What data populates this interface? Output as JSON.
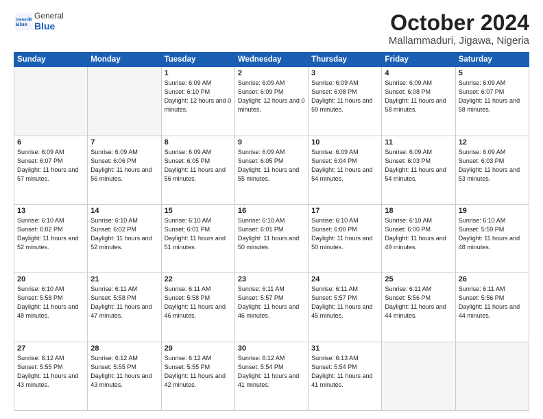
{
  "header": {
    "logo_general": "General",
    "logo_blue": "Blue",
    "title": "October 2024",
    "subtitle": "Mallammaduri, Jigawa, Nigeria"
  },
  "weekdays": [
    "Sunday",
    "Monday",
    "Tuesday",
    "Wednesday",
    "Thursday",
    "Friday",
    "Saturday"
  ],
  "weeks": [
    [
      {
        "day": "",
        "sunrise": "",
        "sunset": "",
        "daylight": ""
      },
      {
        "day": "",
        "sunrise": "",
        "sunset": "",
        "daylight": ""
      },
      {
        "day": "1",
        "sunrise": "Sunrise: 6:09 AM",
        "sunset": "Sunset: 6:10 PM",
        "daylight": "Daylight: 12 hours and 0 minutes."
      },
      {
        "day": "2",
        "sunrise": "Sunrise: 6:09 AM",
        "sunset": "Sunset: 6:09 PM",
        "daylight": "Daylight: 12 hours and 0 minutes."
      },
      {
        "day": "3",
        "sunrise": "Sunrise: 6:09 AM",
        "sunset": "Sunset: 6:08 PM",
        "daylight": "Daylight: 11 hours and 59 minutes."
      },
      {
        "day": "4",
        "sunrise": "Sunrise: 6:09 AM",
        "sunset": "Sunset: 6:08 PM",
        "daylight": "Daylight: 11 hours and 58 minutes."
      },
      {
        "day": "5",
        "sunrise": "Sunrise: 6:09 AM",
        "sunset": "Sunset: 6:07 PM",
        "daylight": "Daylight: 11 hours and 58 minutes."
      }
    ],
    [
      {
        "day": "6",
        "sunrise": "Sunrise: 6:09 AM",
        "sunset": "Sunset: 6:07 PM",
        "daylight": "Daylight: 11 hours and 57 minutes."
      },
      {
        "day": "7",
        "sunrise": "Sunrise: 6:09 AM",
        "sunset": "Sunset: 6:06 PM",
        "daylight": "Daylight: 11 hours and 56 minutes."
      },
      {
        "day": "8",
        "sunrise": "Sunrise: 6:09 AM",
        "sunset": "Sunset: 6:05 PM",
        "daylight": "Daylight: 11 hours and 56 minutes."
      },
      {
        "day": "9",
        "sunrise": "Sunrise: 6:09 AM",
        "sunset": "Sunset: 6:05 PM",
        "daylight": "Daylight: 11 hours and 55 minutes."
      },
      {
        "day": "10",
        "sunrise": "Sunrise: 6:09 AM",
        "sunset": "Sunset: 6:04 PM",
        "daylight": "Daylight: 11 hours and 54 minutes."
      },
      {
        "day": "11",
        "sunrise": "Sunrise: 6:09 AM",
        "sunset": "Sunset: 6:03 PM",
        "daylight": "Daylight: 11 hours and 54 minutes."
      },
      {
        "day": "12",
        "sunrise": "Sunrise: 6:09 AM",
        "sunset": "Sunset: 6:03 PM",
        "daylight": "Daylight: 11 hours and 53 minutes."
      }
    ],
    [
      {
        "day": "13",
        "sunrise": "Sunrise: 6:10 AM",
        "sunset": "Sunset: 6:02 PM",
        "daylight": "Daylight: 11 hours and 52 minutes."
      },
      {
        "day": "14",
        "sunrise": "Sunrise: 6:10 AM",
        "sunset": "Sunset: 6:02 PM",
        "daylight": "Daylight: 11 hours and 52 minutes."
      },
      {
        "day": "15",
        "sunrise": "Sunrise: 6:10 AM",
        "sunset": "Sunset: 6:01 PM",
        "daylight": "Daylight: 11 hours and 51 minutes."
      },
      {
        "day": "16",
        "sunrise": "Sunrise: 6:10 AM",
        "sunset": "Sunset: 6:01 PM",
        "daylight": "Daylight: 11 hours and 50 minutes."
      },
      {
        "day": "17",
        "sunrise": "Sunrise: 6:10 AM",
        "sunset": "Sunset: 6:00 PM",
        "daylight": "Daylight: 11 hours and 50 minutes."
      },
      {
        "day": "18",
        "sunrise": "Sunrise: 6:10 AM",
        "sunset": "Sunset: 6:00 PM",
        "daylight": "Daylight: 11 hours and 49 minutes."
      },
      {
        "day": "19",
        "sunrise": "Sunrise: 6:10 AM",
        "sunset": "Sunset: 5:59 PM",
        "daylight": "Daylight: 11 hours and 48 minutes."
      }
    ],
    [
      {
        "day": "20",
        "sunrise": "Sunrise: 6:10 AM",
        "sunset": "Sunset: 5:58 PM",
        "daylight": "Daylight: 11 hours and 48 minutes."
      },
      {
        "day": "21",
        "sunrise": "Sunrise: 6:11 AM",
        "sunset": "Sunset: 5:58 PM",
        "daylight": "Daylight: 11 hours and 47 minutes."
      },
      {
        "day": "22",
        "sunrise": "Sunrise: 6:11 AM",
        "sunset": "Sunset: 5:58 PM",
        "daylight": "Daylight: 11 hours and 46 minutes."
      },
      {
        "day": "23",
        "sunrise": "Sunrise: 6:11 AM",
        "sunset": "Sunset: 5:57 PM",
        "daylight": "Daylight: 11 hours and 46 minutes."
      },
      {
        "day": "24",
        "sunrise": "Sunrise: 6:11 AM",
        "sunset": "Sunset: 5:57 PM",
        "daylight": "Daylight: 11 hours and 45 minutes."
      },
      {
        "day": "25",
        "sunrise": "Sunrise: 6:11 AM",
        "sunset": "Sunset: 5:56 PM",
        "daylight": "Daylight: 11 hours and 44 minutes."
      },
      {
        "day": "26",
        "sunrise": "Sunrise: 6:11 AM",
        "sunset": "Sunset: 5:56 PM",
        "daylight": "Daylight: 11 hours and 44 minutes."
      }
    ],
    [
      {
        "day": "27",
        "sunrise": "Sunrise: 6:12 AM",
        "sunset": "Sunset: 5:55 PM",
        "daylight": "Daylight: 11 hours and 43 minutes."
      },
      {
        "day": "28",
        "sunrise": "Sunrise: 6:12 AM",
        "sunset": "Sunset: 5:55 PM",
        "daylight": "Daylight: 11 hours and 43 minutes."
      },
      {
        "day": "29",
        "sunrise": "Sunrise: 6:12 AM",
        "sunset": "Sunset: 5:55 PM",
        "daylight": "Daylight: 11 hours and 42 minutes."
      },
      {
        "day": "30",
        "sunrise": "Sunrise: 6:12 AM",
        "sunset": "Sunset: 5:54 PM",
        "daylight": "Daylight: 11 hours and 41 minutes."
      },
      {
        "day": "31",
        "sunrise": "Sunrise: 6:13 AM",
        "sunset": "Sunset: 5:54 PM",
        "daylight": "Daylight: 11 hours and 41 minutes."
      },
      {
        "day": "",
        "sunrise": "",
        "sunset": "",
        "daylight": ""
      },
      {
        "day": "",
        "sunrise": "",
        "sunset": "",
        "daylight": ""
      }
    ]
  ]
}
